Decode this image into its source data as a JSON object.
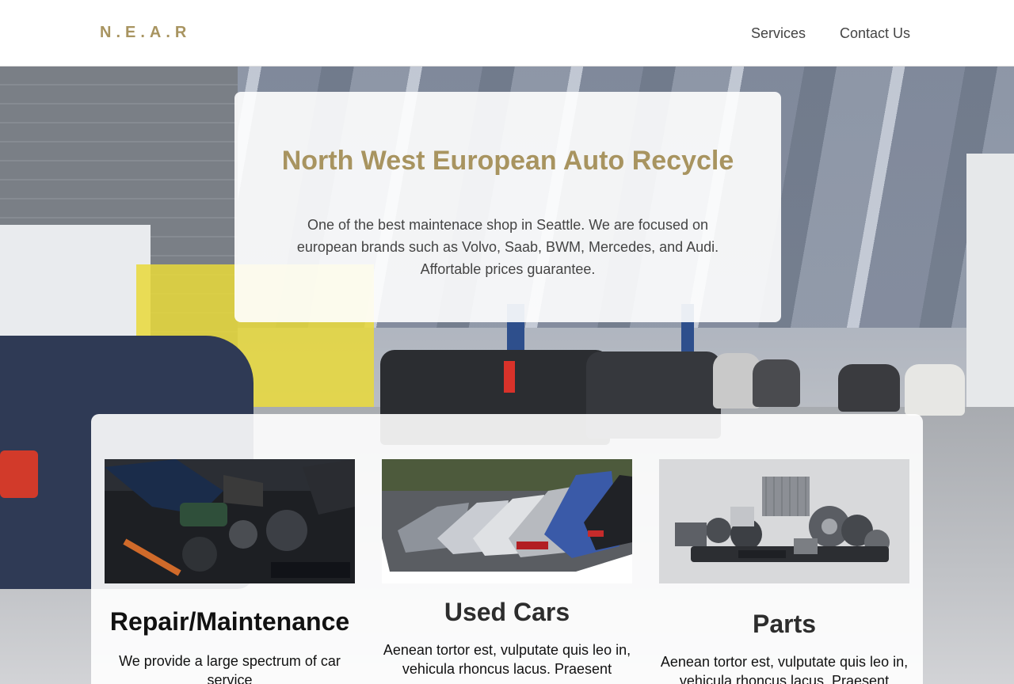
{
  "navbar": {
    "brand": "N.E.A.R",
    "links": [
      "Services",
      "Contact Us"
    ]
  },
  "intro": {
    "title": "North West European Auto Recycle",
    "description": "One of the best maintenace shop in Seattle. We are focused on european brands such as Volvo, Saab, BWM, Mercedes, and Audi. Affortable prices guarantee."
  },
  "services": [
    {
      "title": "Repair/Maintenance",
      "text": "We provide a large spectrum of car service",
      "image": "engine-repair-photo"
    },
    {
      "title": "Used Cars",
      "text": "Aenean tortor est, vulputate quis leo in, vehicula rhoncus lacus. Praesent",
      "image": "parked-cars-photo"
    },
    {
      "title": "Parts",
      "text": "Aenean tortor est, vulputate quis leo in, vehicula rhoncus lacus. Praesent",
      "image": "auto-parts-photo"
    }
  ],
  "colors": {
    "brand": "#a89460",
    "nav_text": "#444444",
    "heading_dark": "#2d2d2d"
  }
}
